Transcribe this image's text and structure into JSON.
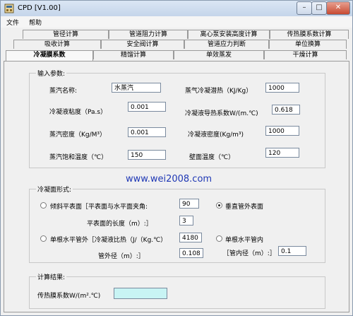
{
  "window": {
    "title": "CPD [V1.00]"
  },
  "menu": [
    "文件",
    "帮助"
  ],
  "tabs": {
    "row1": [
      "管径计算",
      "管道阻力计算",
      "离心泵安装高度计算",
      "传热膜系数计算"
    ],
    "row2": [
      "吸收计算",
      "安全阀计算",
      "管道应力判断",
      "单位换算"
    ],
    "row3": [
      "冷凝膜系数",
      "精馏计算",
      "单效蒸发",
      "干燥计算"
    ]
  },
  "input_group": {
    "title": "输入参数:",
    "vapor_name_label": "蒸汽名称:",
    "vapor_name_value": "水蒸汽",
    "latent_heat_label": "蒸气冷凝潜热（KJ/Kg）",
    "latent_heat_value": "1000",
    "viscosity_label": "冷凝液粘度（Pa.s）",
    "viscosity_value": "0.001",
    "conductivity_label": "冷凝液导热系数W/(m.℃)",
    "conductivity_value": "0.618",
    "vapor_density_label": "蒸汽密度（Kg/M³）",
    "vapor_density_value": "0.001",
    "liquid_density_label": "冷凝液密度(Kg/m³)",
    "liquid_density_value": "1000",
    "sat_temp_label": "蒸汽饱和温度（℃）",
    "sat_temp_value": "150",
    "wall_temp_label": "壁面温度（℃）",
    "wall_temp_value": "120"
  },
  "watermark": "www.wei2008.com",
  "form_group": {
    "title": "冷凝面形式:",
    "inclined_label": "倾斜平表面［平表面与水平面夹角:",
    "inclined_value": "90",
    "inclined_length_label": "平表面的长度（m）:］",
    "inclined_length_value": "3",
    "vertical_label": "垂直管外表面",
    "single_outer_label": "单根水平管外［冷凝液比热（J/（Kg.℃）",
    "specific_heat_value": "4180",
    "outer_diameter_label": "管外径（m）:］",
    "outer_diameter_value": "0.108",
    "single_inner_label": "单根水平管内",
    "inner_diameter_label": "［管内径（m）:］",
    "inner_diameter_value": "0.1"
  },
  "result_group": {
    "title": "计算结果:",
    "coef_label": "传热膜系数W/(m².℃)",
    "coef_value": ""
  },
  "colors": {
    "result_field": "#c8f4f4",
    "watermark": "#1f38b5"
  }
}
